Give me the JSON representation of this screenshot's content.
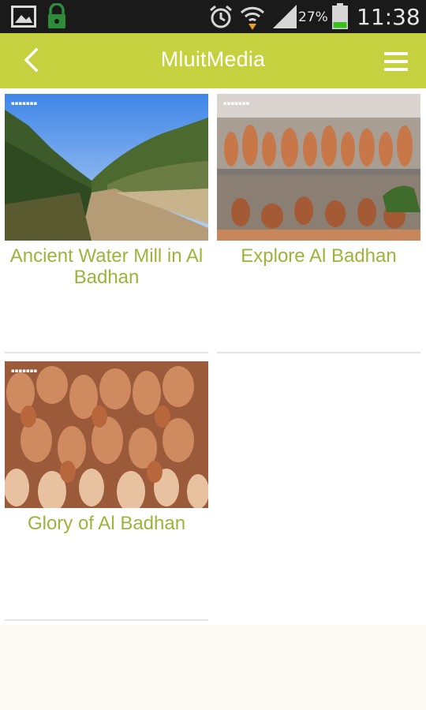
{
  "status_bar": {
    "battery": "27%",
    "time": "11:38",
    "icons": [
      "gallery-icon",
      "lock-icon",
      "alarm-icon",
      "wifi-icon",
      "signal-icon",
      "battery-icon"
    ]
  },
  "app_bar": {
    "title": "MluitMedia",
    "back_icon": "chevron-left-icon",
    "menu_icon": "hamburger-menu-icon",
    "color": "#c5d13f"
  },
  "cards": [
    {
      "title": "Ancient Water Mill in Al Badhan",
      "image": "dirt road through olive grove"
    },
    {
      "title": "Explore Al Badhan",
      "image": "pottery display shelves"
    },
    {
      "title": "Glory of Al Badhan",
      "image": "clay jars pile"
    }
  ],
  "colors": {
    "caption": "#9cb43a",
    "app_bar": "#c5d13f"
  }
}
